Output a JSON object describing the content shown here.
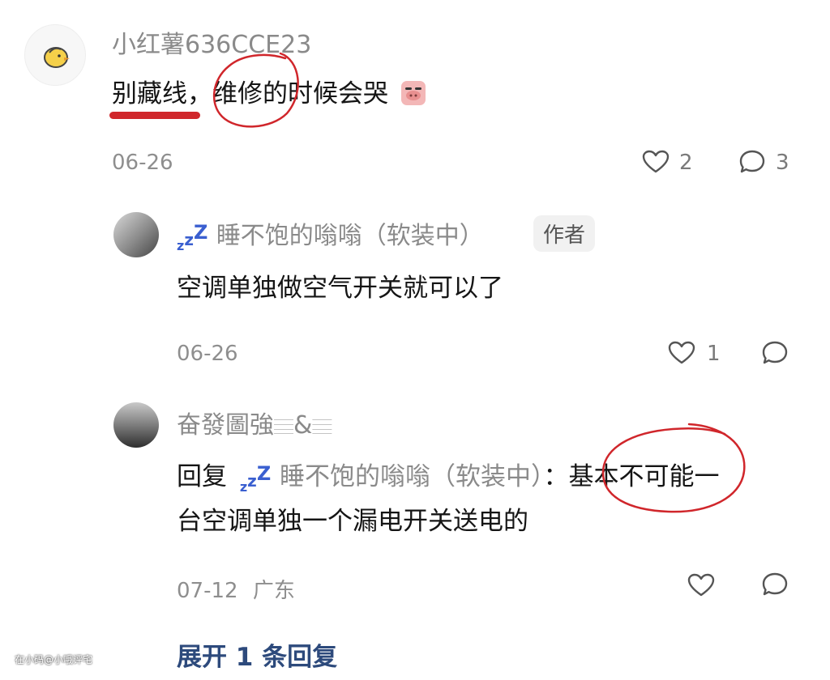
{
  "comment": {
    "username": "小红薯636CCE23",
    "text": "别藏线，维修的时候会哭",
    "emoji_icon": "crying-pig-emoji",
    "date": "06-26",
    "like_count": "2",
    "reply_count": "3"
  },
  "replies": [
    {
      "username": "睡不饱的嗡嗡（软装中）",
      "badge": "作者",
      "text": "空调单独做空气开关就可以了",
      "date": "06-26",
      "like_count": "1"
    },
    {
      "username": "奋發圖強𝄙&𝄙",
      "reply_prefix": "回复",
      "reply_to": "睡不饱的嗡嗡（软装中）",
      "text_line1": "：基本不可能一",
      "text_line2": "台空调单独一个漏电开关送电的",
      "date": "07-12",
      "location": "广东"
    }
  ],
  "expand_label": "展开 1 条回复",
  "watermark": "在小码@小哦评宅",
  "colors": {
    "annotation_red": "#d0262b",
    "link_blue": "#2d4a7c",
    "zzz_blue": "#3a5fd0"
  }
}
